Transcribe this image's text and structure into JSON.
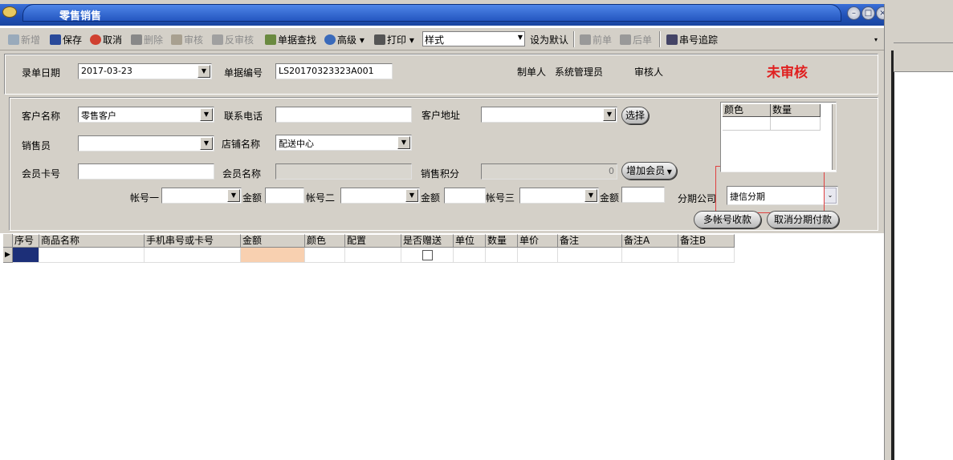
{
  "window": {
    "title": "零售销售"
  },
  "toolbar": {
    "new": "新增",
    "save": "保存",
    "cancel": "取消",
    "delete": "删除",
    "audit": "审核",
    "unaudit": "反审核",
    "doc_search": "单据查找",
    "advanced": "高级",
    "print": "打印",
    "style_value": "样式",
    "set_default": "设为默认",
    "prev": "前单",
    "next": "后单",
    "serial_track": "串号追踪"
  },
  "header": {
    "date_label": "录单日期",
    "date_value": "2017-03-23",
    "docno_label": "单据编号",
    "docno_value": "LS20170323323A001",
    "maker_label": "制单人",
    "maker_value": "系统管理员",
    "auditor_label": "审核人",
    "status": "未审核"
  },
  "form": {
    "customer_label": "客户名称",
    "customer_value": "零售客户",
    "phone_label": "联系电话",
    "address_label": "客户地址",
    "select_button": "选择",
    "salesperson_label": "销售员",
    "store_label": "店铺名称",
    "store_value": "配送中心",
    "member_card_label": "会员卡号",
    "member_name_label": "会员名称",
    "points_label": "销售积分",
    "points_value": "0",
    "add_member_button": "增加会员",
    "account1_label": "帐号一",
    "amount_label": "金额",
    "account2_label": "帐号二",
    "account3_label": "帐号三",
    "installment_label": "分期公司",
    "installment_value": "捷信分期",
    "multi_account_button": "多帐号收款",
    "cancel_installment_button": "取消分期付款"
  },
  "color_table": {
    "headers": [
      "颜色",
      "数量"
    ]
  },
  "grid": {
    "headers": [
      "序号",
      "商品名称",
      "手机串号或卡号",
      "金额",
      "颜色",
      "配置",
      "是否赠送",
      "单位",
      "数量",
      "单价",
      "备注",
      "备注A",
      "备注B"
    ]
  },
  "colors": {
    "status": "#e02020",
    "title_bar": "#2456c0",
    "amount_cell": "#f8d0b0",
    "selected_cell": "#1c2f78"
  }
}
